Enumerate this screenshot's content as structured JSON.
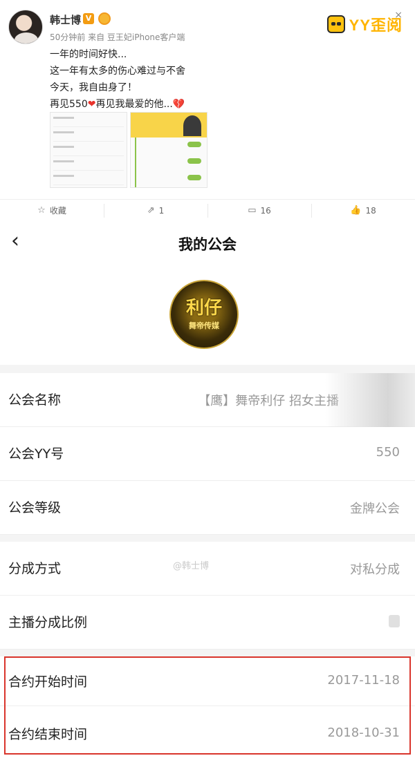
{
  "post": {
    "author": "韩士博",
    "v_badge": "V",
    "meta": "50分钟前  来自 豆王妃iPhone客户端",
    "lines": [
      "一年的时间好快...",
      "这一年有太多的伤心难过与不舍",
      "今天，我自由身了！",
      "再见550",
      "再见我最爱的他..."
    ],
    "heart": "❤",
    "broken_heart": "💔",
    "close": "×",
    "logo_text": "YY歪阅"
  },
  "actions": [
    {
      "icon": "star-icon",
      "glyph": "☆",
      "label": "收藏"
    },
    {
      "icon": "share-icon",
      "glyph": "⇗",
      "label": "1"
    },
    {
      "icon": "comment-icon",
      "glyph": "▭",
      "label": "16"
    },
    {
      "icon": "like-icon",
      "glyph": "👍",
      "label": "18"
    }
  ],
  "nav": {
    "back": "‹",
    "title": "我的公会"
  },
  "guild_logo": {
    "big": "利仔",
    "small": "舞帝传媒"
  },
  "rows": {
    "name": {
      "label": "公会名称",
      "value": "【鹰】舞帝利仔 招女主播"
    },
    "yy": {
      "label": "公会YY号",
      "value": "550"
    },
    "level": {
      "label": "公会等级",
      "value": "金牌公会"
    },
    "split": {
      "label": "分成方式",
      "value": "对私分成"
    },
    "ratio": {
      "label": "主播分成比例",
      "value": ""
    },
    "start": {
      "label": "合约开始时间",
      "value": "2017-11-18"
    },
    "end": {
      "label": "合约结束时间",
      "value": "2018-10-31"
    }
  },
  "watermark": "@韩士博",
  "colors": {
    "highlight_border": "#d9342b",
    "logo_yellow": "#ffb400",
    "value_gray": "#999999"
  }
}
